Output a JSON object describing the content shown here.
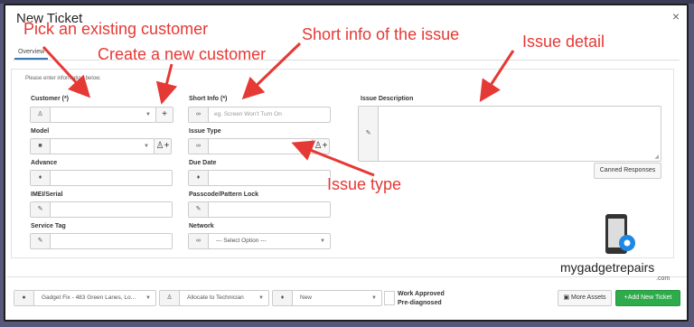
{
  "modal": {
    "title": "New Ticket",
    "close": "×"
  },
  "tabs": [
    "Overview"
  ],
  "hint": "Please enter information below.",
  "fields": {
    "customer_label": "Customer (*)",
    "customer_add": "+",
    "model_label": "Model",
    "advance_label": "Advance",
    "imei_label": "IMEI/Serial",
    "service_tag_label": "Service Tag",
    "short_info_label": "Short Info (*)",
    "short_info_placeholder": "eg. Screen Won't Turn On",
    "issue_type_label": "Issue Type",
    "due_date_label": "Due Date",
    "passcode_label": "Passcode/Pattern Lock",
    "network_label": "Network",
    "network_value": "--- Select Option ---",
    "issue_desc_label": "Issue Description",
    "canned_responses": "Canned Responses"
  },
  "footer": {
    "location": "Gadget Fix - 483 Green Lanes, Lo...",
    "technician": "Allocate to Technician",
    "status": "New",
    "work_approved": "Work Approved",
    "pre_diagnosed": "Pre-diagnosed",
    "more_assets": "More Assets",
    "add_new_ticket": "Add New Ticket"
  },
  "annotations": {
    "pick_customer": "Pick an existing customer",
    "create_customer": "Create a new customer",
    "short_info": "Short info of the issue",
    "issue_detail": "Issue detail",
    "issue_type": "Issue type"
  },
  "logo": {
    "text": "mygadgetrepairs",
    "suffix": ".com"
  },
  "colors": {
    "accent": "#e53935",
    "primary": "#337ab7",
    "success": "#2eab4a",
    "backdrop": "#58587a"
  },
  "icons": {
    "user": "user-icon",
    "folder": "folder-icon",
    "tag": "tag-icon",
    "edit": "edit-icon",
    "link": "link-icon",
    "map_marker": "map-marker-icon",
    "add_user": "add-user-icon"
  }
}
